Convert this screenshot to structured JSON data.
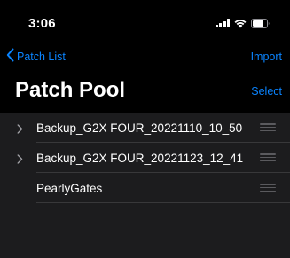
{
  "status_bar": {
    "time": "3:06"
  },
  "nav": {
    "back_label": "Patch List",
    "import_label": "Import"
  },
  "title": {
    "text": "Patch Pool",
    "select_label": "Select"
  },
  "patches": {
    "items": [
      {
        "label": "Backup_G2X FOUR_20221110_10_50",
        "expandable": true
      },
      {
        "label": "Backup_G2X FOUR_20221123_12_41",
        "expandable": true
      },
      {
        "label": "PearlyGates",
        "expandable": false
      }
    ]
  },
  "colors": {
    "accent": "#0a84ff",
    "background": "#000000",
    "list_background": "#1c1c1e",
    "separator": "#38383a"
  },
  "icons": {
    "back": "chevron-left-icon",
    "disclosure": "chevron-right-icon",
    "reorder": "reorder-handle-icon",
    "signal": "cellular-signal-icon",
    "wifi": "wifi-icon",
    "battery": "battery-icon"
  }
}
